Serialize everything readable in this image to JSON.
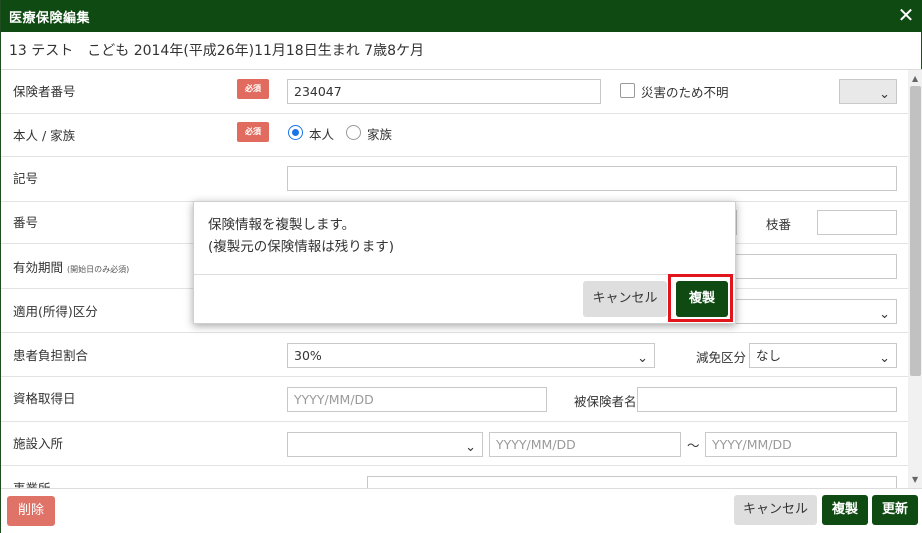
{
  "window": {
    "title": "医療保険編集",
    "close_glyph": "✕"
  },
  "patient_header": "13 テスト　こども 2014年(平成26年)11月18日生まれ 7歳8ケ月",
  "required_badge": "必須",
  "fields": {
    "insurer_number": {
      "label": "保険者番号",
      "value": "234047",
      "disaster_label": "災害のため不明"
    },
    "person_family": {
      "label": "本人 / 家族",
      "options": [
        "本人",
        "家族"
      ],
      "selected": "本人"
    },
    "symbol": {
      "label": "記号",
      "value": ""
    },
    "number": {
      "label": "番号",
      "value": "",
      "branch_label": "枝番"
    },
    "valid_period": {
      "label": "有効期間",
      "note": "(開始日のみ必須)"
    },
    "income_class": {
      "label": "適用(所得)区分"
    },
    "copay_ratio": {
      "label": "患者負担割合",
      "value": "30%",
      "exemption_label": "減免区分",
      "exemption_value": "なし"
    },
    "acquired_date": {
      "label": "資格取得日",
      "placeholder": "YYYY/MM/DD",
      "insured_name_label": "被保険者名"
    },
    "facility": {
      "label": "施設入所",
      "from_placeholder": "YYYY/MM/DD",
      "tilde": "～",
      "to_placeholder": "YYYY/MM/DD"
    },
    "office": {
      "label": "事業所"
    }
  },
  "footer": {
    "delete": "削除",
    "cancel": "キャンセル",
    "duplicate": "複製",
    "update": "更新"
  },
  "confirm_dialog": {
    "line1": "保険情報を複製します。",
    "line2": "(複製元の保険情報は残ります)",
    "cancel": "キャンセル",
    "ok": "複製"
  },
  "colors": {
    "titlebar": "#0e4a12",
    "required": "#e06b5e",
    "delete": "#e07368",
    "highlight": "#e0161c"
  },
  "icons": {
    "close": "close-icon",
    "chevron": "chevron-down-icon"
  }
}
